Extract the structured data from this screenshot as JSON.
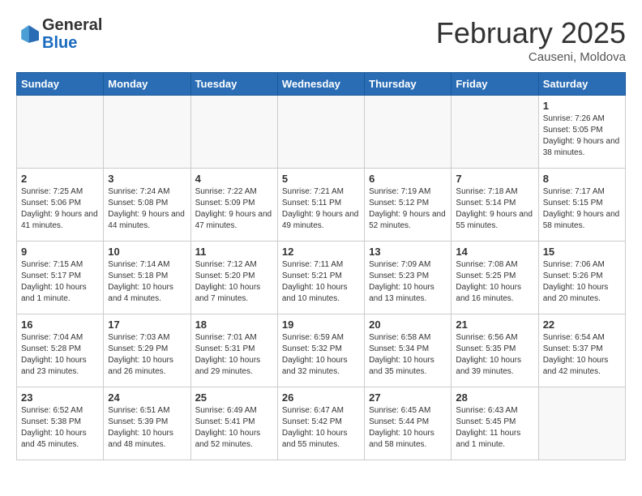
{
  "header": {
    "logo_general": "General",
    "logo_blue": "Blue",
    "month_title": "February 2025",
    "location": "Causeni, Moldova"
  },
  "weekdays": [
    "Sunday",
    "Monday",
    "Tuesday",
    "Wednesday",
    "Thursday",
    "Friday",
    "Saturday"
  ],
  "weeks": [
    [
      {
        "day": "",
        "info": ""
      },
      {
        "day": "",
        "info": ""
      },
      {
        "day": "",
        "info": ""
      },
      {
        "day": "",
        "info": ""
      },
      {
        "day": "",
        "info": ""
      },
      {
        "day": "",
        "info": ""
      },
      {
        "day": "1",
        "info": "Sunrise: 7:26 AM\nSunset: 5:05 PM\nDaylight: 9 hours and 38 minutes."
      }
    ],
    [
      {
        "day": "2",
        "info": "Sunrise: 7:25 AM\nSunset: 5:06 PM\nDaylight: 9 hours and 41 minutes."
      },
      {
        "day": "3",
        "info": "Sunrise: 7:24 AM\nSunset: 5:08 PM\nDaylight: 9 hours and 44 minutes."
      },
      {
        "day": "4",
        "info": "Sunrise: 7:22 AM\nSunset: 5:09 PM\nDaylight: 9 hours and 47 minutes."
      },
      {
        "day": "5",
        "info": "Sunrise: 7:21 AM\nSunset: 5:11 PM\nDaylight: 9 hours and 49 minutes."
      },
      {
        "day": "6",
        "info": "Sunrise: 7:19 AM\nSunset: 5:12 PM\nDaylight: 9 hours and 52 minutes."
      },
      {
        "day": "7",
        "info": "Sunrise: 7:18 AM\nSunset: 5:14 PM\nDaylight: 9 hours and 55 minutes."
      },
      {
        "day": "8",
        "info": "Sunrise: 7:17 AM\nSunset: 5:15 PM\nDaylight: 9 hours and 58 minutes."
      }
    ],
    [
      {
        "day": "9",
        "info": "Sunrise: 7:15 AM\nSunset: 5:17 PM\nDaylight: 10 hours and 1 minute."
      },
      {
        "day": "10",
        "info": "Sunrise: 7:14 AM\nSunset: 5:18 PM\nDaylight: 10 hours and 4 minutes."
      },
      {
        "day": "11",
        "info": "Sunrise: 7:12 AM\nSunset: 5:20 PM\nDaylight: 10 hours and 7 minutes."
      },
      {
        "day": "12",
        "info": "Sunrise: 7:11 AM\nSunset: 5:21 PM\nDaylight: 10 hours and 10 minutes."
      },
      {
        "day": "13",
        "info": "Sunrise: 7:09 AM\nSunset: 5:23 PM\nDaylight: 10 hours and 13 minutes."
      },
      {
        "day": "14",
        "info": "Sunrise: 7:08 AM\nSunset: 5:25 PM\nDaylight: 10 hours and 16 minutes."
      },
      {
        "day": "15",
        "info": "Sunrise: 7:06 AM\nSunset: 5:26 PM\nDaylight: 10 hours and 20 minutes."
      }
    ],
    [
      {
        "day": "16",
        "info": "Sunrise: 7:04 AM\nSunset: 5:28 PM\nDaylight: 10 hours and 23 minutes."
      },
      {
        "day": "17",
        "info": "Sunrise: 7:03 AM\nSunset: 5:29 PM\nDaylight: 10 hours and 26 minutes."
      },
      {
        "day": "18",
        "info": "Sunrise: 7:01 AM\nSunset: 5:31 PM\nDaylight: 10 hours and 29 minutes."
      },
      {
        "day": "19",
        "info": "Sunrise: 6:59 AM\nSunset: 5:32 PM\nDaylight: 10 hours and 32 minutes."
      },
      {
        "day": "20",
        "info": "Sunrise: 6:58 AM\nSunset: 5:34 PM\nDaylight: 10 hours and 35 minutes."
      },
      {
        "day": "21",
        "info": "Sunrise: 6:56 AM\nSunset: 5:35 PM\nDaylight: 10 hours and 39 minutes."
      },
      {
        "day": "22",
        "info": "Sunrise: 6:54 AM\nSunset: 5:37 PM\nDaylight: 10 hours and 42 minutes."
      }
    ],
    [
      {
        "day": "23",
        "info": "Sunrise: 6:52 AM\nSunset: 5:38 PM\nDaylight: 10 hours and 45 minutes."
      },
      {
        "day": "24",
        "info": "Sunrise: 6:51 AM\nSunset: 5:39 PM\nDaylight: 10 hours and 48 minutes."
      },
      {
        "day": "25",
        "info": "Sunrise: 6:49 AM\nSunset: 5:41 PM\nDaylight: 10 hours and 52 minutes."
      },
      {
        "day": "26",
        "info": "Sunrise: 6:47 AM\nSunset: 5:42 PM\nDaylight: 10 hours and 55 minutes."
      },
      {
        "day": "27",
        "info": "Sunrise: 6:45 AM\nSunset: 5:44 PM\nDaylight: 10 hours and 58 minutes."
      },
      {
        "day": "28",
        "info": "Sunrise: 6:43 AM\nSunset: 5:45 PM\nDaylight: 11 hours and 1 minute."
      },
      {
        "day": "",
        "info": ""
      }
    ]
  ]
}
